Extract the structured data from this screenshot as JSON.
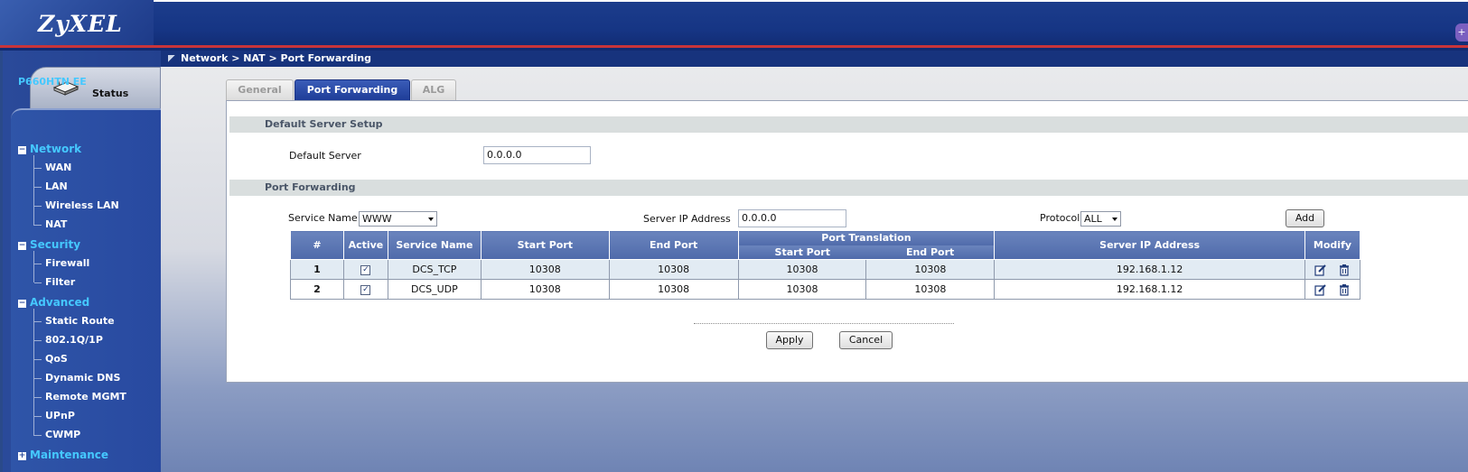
{
  "header": {
    "logo": "ZyXEL"
  },
  "breadcrumb": "Network > NAT > Port Forwarding",
  "sidebar": {
    "status_label": "Status",
    "device_name": "P660HTN EE",
    "groups": [
      {
        "label": "Network",
        "toggle": "−",
        "items": [
          "WAN",
          "LAN",
          "Wireless LAN",
          "NAT"
        ]
      },
      {
        "label": "Security",
        "toggle": "−",
        "items": [
          "Firewall",
          "Filter"
        ]
      },
      {
        "label": "Advanced",
        "toggle": "−",
        "items": [
          "Static Route",
          "802.1Q/1P",
          "QoS",
          "Dynamic DNS",
          "Remote MGMT",
          "UPnP",
          "CWMP"
        ]
      },
      {
        "label": "Maintenance",
        "toggle": "+",
        "items": []
      }
    ]
  },
  "tabs": [
    {
      "label": "General",
      "active": false
    },
    {
      "label": "Port Forwarding",
      "active": true
    },
    {
      "label": "ALG",
      "active": false
    }
  ],
  "default_server_section": {
    "title": "Default Server Setup",
    "field_label": "Default Server",
    "field_value": "0.0.0.0"
  },
  "port_forwarding_section": {
    "title": "Port Forwarding",
    "service_name_label": "Service Name",
    "service_name_value": "WWW",
    "server_ip_label": "Server IP Address",
    "server_ip_value": "0.0.0.0",
    "protocol_label": "Protocol",
    "protocol_value": "ALL",
    "add_label": "Add"
  },
  "table": {
    "headers": {
      "num": "#",
      "active": "Active",
      "service_name": "Service Name",
      "start_port": "Start Port",
      "end_port": "End Port",
      "port_translation": "Port Translation",
      "pt_start_port": "Start Port",
      "pt_end_port": "End Port",
      "server_ip": "Server IP Address",
      "modify": "Modify"
    },
    "rows": [
      {
        "num": "1",
        "active": true,
        "service_name": "DCS_TCP",
        "start_port": "10308",
        "end_port": "10308",
        "pt_start_port": "10308",
        "pt_end_port": "10308",
        "server_ip": "192.168.1.12"
      },
      {
        "num": "2",
        "active": true,
        "service_name": "DCS_UDP",
        "start_port": "10308",
        "end_port": "10308",
        "pt_start_port": "10308",
        "pt_end_port": "10308",
        "server_ip": "192.168.1.12"
      }
    ]
  },
  "actions": {
    "apply": "Apply",
    "cancel": "Cancel"
  }
}
